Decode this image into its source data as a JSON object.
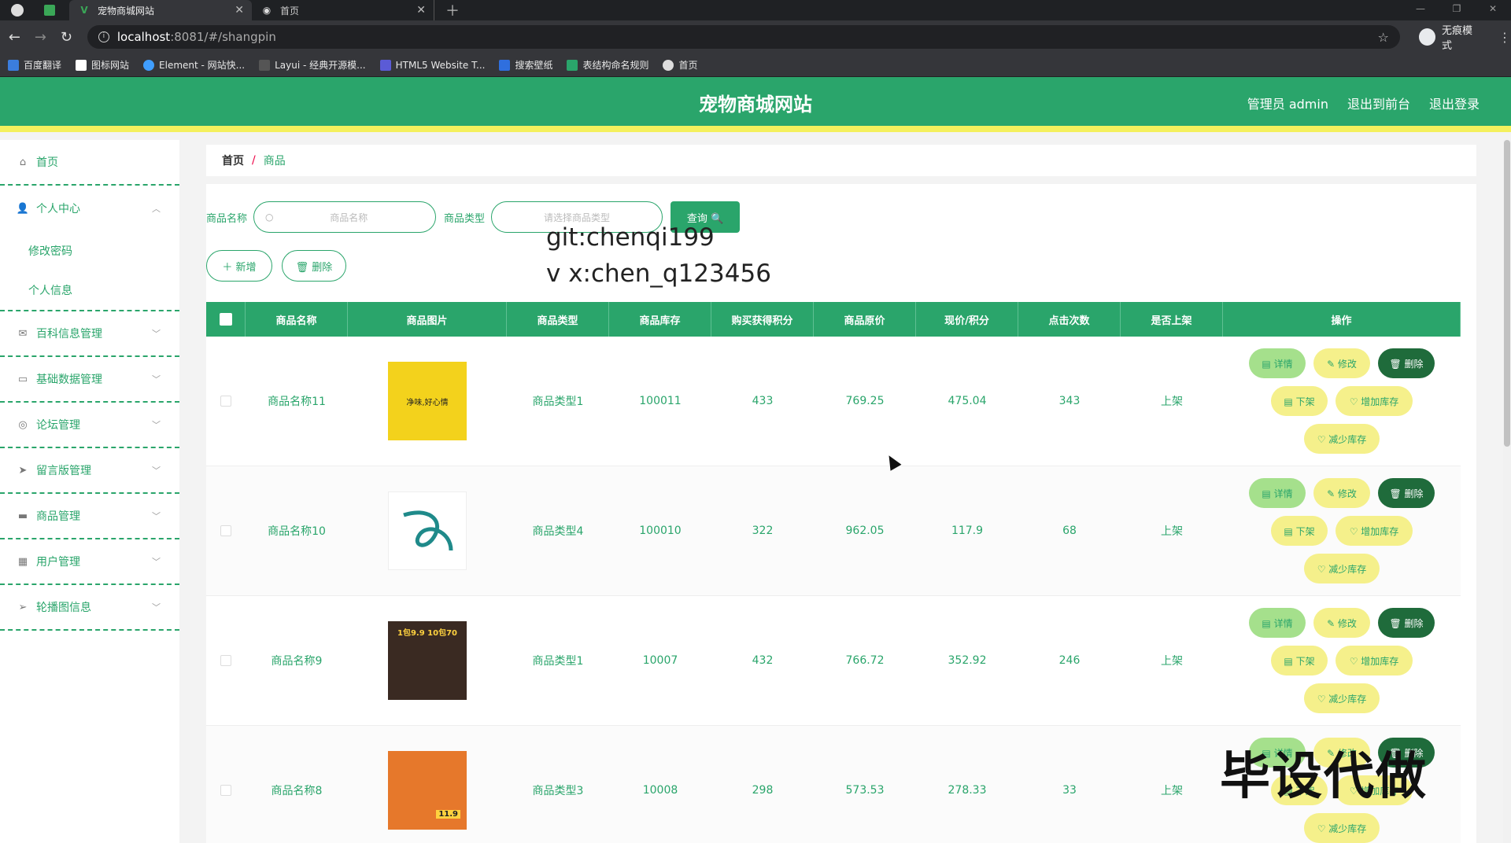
{
  "browser": {
    "tabs": [
      {
        "label": "宠物商城网站",
        "active": true
      },
      {
        "label": "首页",
        "active": false
      }
    ],
    "url_host": "localhost",
    "url_path": ":8081/#/shangpin",
    "incognito_label": "无痕模式",
    "bookmarks": [
      "百度翻译",
      "图标网站",
      "Element - 网站快...",
      "Layui - 经典开源模...",
      "HTML5 Website T...",
      "搜索壁纸",
      "表结构命名规则",
      "首页"
    ]
  },
  "header": {
    "title": "宠物商城网站",
    "admin": "管理员 admin",
    "to_front": "退出到前台",
    "logout": "退出登录"
  },
  "sidebar": {
    "items": [
      {
        "label": "首页",
        "icon": "home-icon"
      },
      {
        "label": "个人中心",
        "icon": "user-icon",
        "children": [
          "修改密码",
          "个人信息"
        ]
      },
      {
        "label": "百科信息管理",
        "icon": "mail-icon"
      },
      {
        "label": "基础数据管理",
        "icon": "chat-icon"
      },
      {
        "label": "论坛管理",
        "icon": "compass-icon"
      },
      {
        "label": "留言版管理",
        "icon": "send-icon"
      },
      {
        "label": "商品管理",
        "icon": "ticket-icon"
      },
      {
        "label": "用户管理",
        "icon": "grid-icon"
      },
      {
        "label": "轮播图信息",
        "icon": "nav-icon"
      }
    ]
  },
  "breadcrumb": {
    "home": "首页",
    "sep": "/",
    "current": "商品"
  },
  "search": {
    "name_label": "商品名称",
    "name_placeholder": "商品名称",
    "type_label": "商品类型",
    "type_placeholder": "请选择商品类型",
    "query_button": "查询 🔍"
  },
  "watermark": {
    "line1": "git:chenqi199",
    "line2": "v x:chen_q123456",
    "stamp": "毕设代做"
  },
  "actions": {
    "add": "＋ 新增",
    "delete": "🗑 删除"
  },
  "table": {
    "headers": [
      "商品名称",
      "商品图片",
      "商品类型",
      "商品库存",
      "购买获得积分",
      "商品原价",
      "现价/积分",
      "点击次数",
      "是否上架",
      "操作"
    ],
    "rows": [
      {
        "name": "商品名称11",
        "type": "商品类型1",
        "stock": "100011",
        "points": "433",
        "orig": "769.25",
        "now": "475.04",
        "clicks": "343",
        "shelf": "上架",
        "img_text": "净味,好心情",
        "img_color": "#f3d21c"
      },
      {
        "name": "商品名称10",
        "type": "商品类型4",
        "stock": "100010",
        "points": "322",
        "orig": "962.05",
        "now": "117.9",
        "clicks": "68",
        "shelf": "上架",
        "img_text": "",
        "img_color": "#ffffff"
      },
      {
        "name": "商品名称9",
        "type": "商品类型1",
        "stock": "10007",
        "points": "432",
        "orig": "766.72",
        "now": "352.92",
        "clicks": "246",
        "shelf": "上架",
        "img_text": "1包9.9 10包70",
        "img_color": "#3a2a22"
      },
      {
        "name": "商品名称8",
        "type": "商品类型3",
        "stock": "10008",
        "points": "298",
        "orig": "573.53",
        "now": "278.33",
        "clicks": "33",
        "shelf": "上架",
        "img_text": "11.9",
        "img_color": "#e6782b"
      }
    ],
    "ops": {
      "detail": "▤ 详情",
      "edit": "✎ 修改",
      "delete": "🗑 删除",
      "off": "▤ 下架",
      "add_stock": "♡ 增加库存",
      "reduce_stock": "♡ 减少库存"
    }
  },
  "colors": {
    "primary": "#2aa56b",
    "accent_yellow": "#f4f05d",
    "dark_green": "#1f6b3b"
  }
}
